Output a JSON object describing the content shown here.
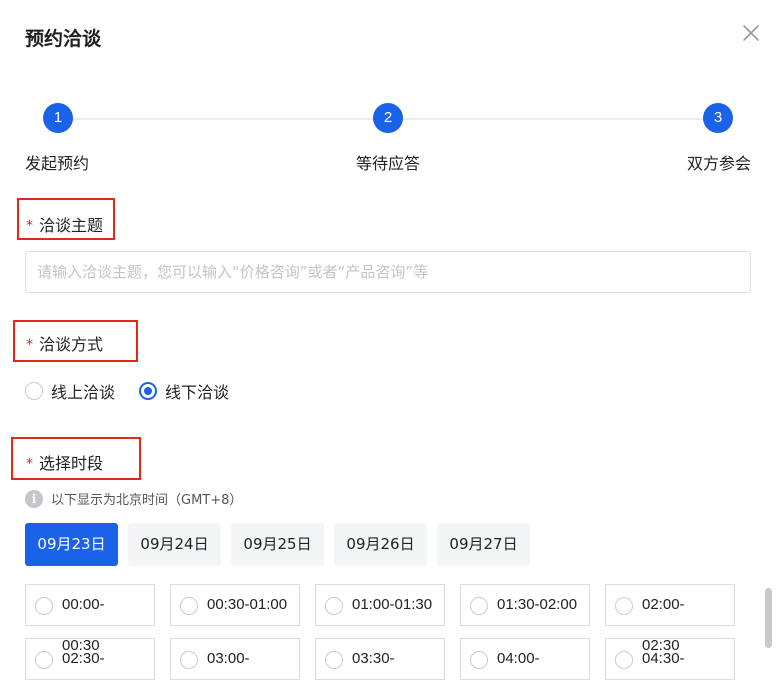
{
  "dialog": {
    "title": "预约洽谈",
    "close_icon": "close-icon"
  },
  "steps": [
    {
      "number": "1",
      "label": "发起预约"
    },
    {
      "number": "2",
      "label": "等待应答"
    },
    {
      "number": "3",
      "label": "双方参会"
    }
  ],
  "topic": {
    "required_mark": "*",
    "label": "洽谈主题",
    "value": "",
    "placeholder": "请输入洽谈主题，您可以输入“价格咨询”或者“产品咨询”等"
  },
  "method": {
    "required_mark": "*",
    "label": "洽谈方式",
    "options": [
      {
        "label": "线上洽谈",
        "selected": false
      },
      {
        "label": "线下洽谈",
        "selected": true
      }
    ]
  },
  "time": {
    "required_mark": "*",
    "label": "选择时段",
    "timezone_note": "以下显示为北京时间（GMT+8）",
    "info_icon": "info-icon",
    "dates": [
      "09月23日",
      "09月24日",
      "09月25日",
      "09月26日",
      "09月27日"
    ],
    "selected_date": "09月23日",
    "slots": [
      "00:00-",
      "00:30-01:00",
      "01:00-01:30",
      "01:30-02:00",
      "02:00-",
      "02:30-",
      "03:00-",
      "03:30-",
      "04:00-",
      "04:30-"
    ],
    "slot_overflow_text": [
      "00:30",
      "02:30"
    ]
  },
  "colors": {
    "primary": "#1a62e8",
    "required": "#e0281b",
    "highlight_box": "#e0281b"
  }
}
